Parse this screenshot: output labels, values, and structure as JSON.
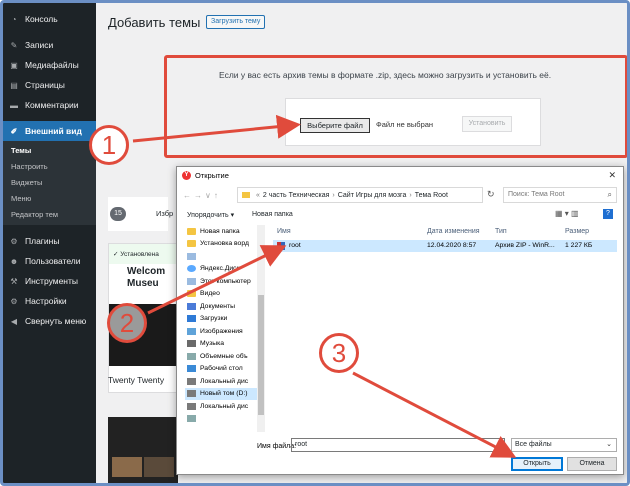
{
  "sidebar": {
    "items": [
      {
        "label": "Консоль",
        "icon": "dashboard-icon"
      },
      {
        "label": "Записи",
        "icon": "pin-icon"
      },
      {
        "label": "Медиафайлы",
        "icon": "media-icon"
      },
      {
        "label": "Страницы",
        "icon": "page-icon"
      },
      {
        "label": "Комментарии",
        "icon": "comment-icon"
      },
      {
        "label": "Внешний вид",
        "icon": "brush-icon"
      }
    ],
    "sub": [
      "Темы",
      "Настроить",
      "Виджеты",
      "Меню",
      "Редактор тем"
    ],
    "items2": [
      {
        "label": "Плагины",
        "icon": "plugin-icon"
      },
      {
        "label": "Пользователи",
        "icon": "users-icon"
      },
      {
        "label": "Инструменты",
        "icon": "tools-icon"
      },
      {
        "label": "Настройки",
        "icon": "settings-icon"
      },
      {
        "label": "Свернуть меню",
        "icon": "collapse-icon"
      }
    ]
  },
  "main": {
    "title": "Добавить темы",
    "upload_button": "Загрузить тему",
    "upload_text": "Если у вас есть архив темы в формате .zip, здесь можно загрузить и установить её.",
    "choose_file": "Выберите файл",
    "no_file": "Файл не выбран",
    "install": "Установить",
    "count": "15",
    "tab_label": "Избр",
    "installed": "✓ Установлена",
    "welcome": "Welcom\nMuseu",
    "theme_name": "Twenty Twenty"
  },
  "dialog": {
    "title": "Открытие",
    "path": [
      "2 часть Техническая",
      "Сайт Игры для мозга",
      "Тема Root"
    ],
    "search_placeholder": "Поиск: Тема Root",
    "organize": "Упорядочить ▾",
    "new_folder": "Новая папка",
    "nav_items": [
      {
        "label": "Новая папка",
        "icon": "folder"
      },
      {
        "label": "Установка ворд",
        "icon": "folder"
      },
      {
        "label": "",
        "icon": "disk"
      },
      {
        "label": "Яндекс.Диск",
        "icon": "cloud"
      },
      {
        "label": "Этот компьютер",
        "icon": "disk"
      },
      {
        "label": "Видео",
        "icon": "folder"
      },
      {
        "label": "Документы",
        "icon": "doc"
      },
      {
        "label": "Загрузки",
        "icon": "dl"
      },
      {
        "label": "Изображения",
        "icon": "img"
      },
      {
        "label": "Музыка",
        "icon": "music"
      },
      {
        "label": "Объемные объ",
        "icon": "obj"
      },
      {
        "label": "Рабочий стол",
        "icon": "desk"
      },
      {
        "label": "Локальный дис",
        "icon": "hdd"
      },
      {
        "label": "Новый том (D:)",
        "icon": "hdd"
      },
      {
        "label": "Локальный дис",
        "icon": "hdd"
      },
      {
        "label": "",
        "icon": "obj"
      }
    ],
    "columns": [
      "Имя",
      "Дата изменения",
      "Тип",
      "Размер"
    ],
    "file": {
      "name": "root",
      "date": "12.04.2020 8:57",
      "type": "Архив ZIP - WinR...",
      "size": "1 227 КБ"
    },
    "filename_label": "Имя файла:",
    "filename_value": "root",
    "filter": "Все файлы",
    "open": "Открыть",
    "cancel": "Отмена"
  },
  "callouts": [
    "1",
    "2",
    "3"
  ],
  "colors": {
    "accent_red": "#e04b3c",
    "wp_blue": "#2271b1",
    "wp_dark": "#1d2327"
  }
}
